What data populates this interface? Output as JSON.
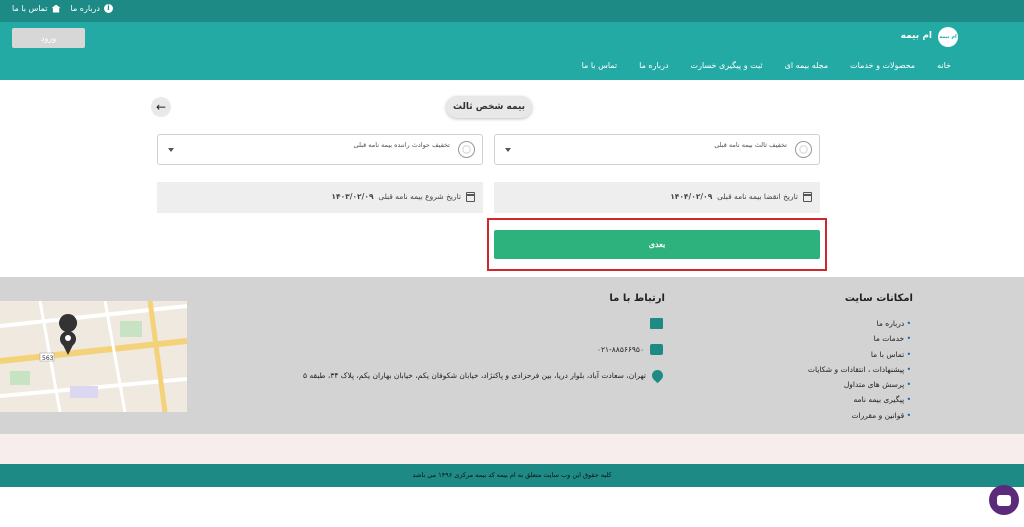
{
  "topbar": {
    "about": "درباره ما",
    "contact": "تماس با ما"
  },
  "header": {
    "brand": "ام بیمه",
    "logo_text": "ام بیمه",
    "login": "ورود",
    "nav": [
      "خانه",
      "محصولات و خدمات",
      "مجله بیمه ای",
      "ثبت و پیگیری خسارت",
      "درباره ما",
      "تماس با ما"
    ]
  },
  "main": {
    "title": "بیمه شخص ثالث",
    "select_third_party": "تخفیف ثالث بیمه نامه قبلی",
    "select_driver": "تخفیف حوادث راننده بیمه نامه قبلی",
    "expiry_label": "تاریخ انقضا بیمه نامه قبلی",
    "expiry_value": "۱۴۰۴/۰۲/۰۹",
    "start_label": "تاریخ شروع بیمه نامه قبلی",
    "start_value": "۱۴۰۳/۰۲/۰۹",
    "next": "بعدی"
  },
  "footer": {
    "features_title": "امکانات سایت",
    "features": [
      "درباره ما",
      "خدمات ما",
      "تماس با ما",
      "پیشنهادات ، انتقادات و شکایات",
      "پرسش های متداول",
      "پیگیری بیمه نامه",
      "قوانین و مقررات"
    ],
    "contact_title": "ارتباط با ما",
    "phone": "۰۲۱-۸۸۵۶۶۹۵۰",
    "address": "تهران، سعادت آباد، بلوار دریا، بین فرحزادی و پاکنژاد، خیابان شکوفان یکم، خیابان بهاران یکم، پلاک ۳۴، طبقه ۵",
    "map_label": "563",
    "copyright": "کلیه حقوق این وب سایت متعلق به ام بیمه کد بیمه مرکزی ۱۴۹۶ می باشد"
  },
  "colors": {
    "primary": "#24aaa4",
    "dark": "#1d8a85",
    "button": "#2db27e",
    "highlight": "#d0262c"
  }
}
